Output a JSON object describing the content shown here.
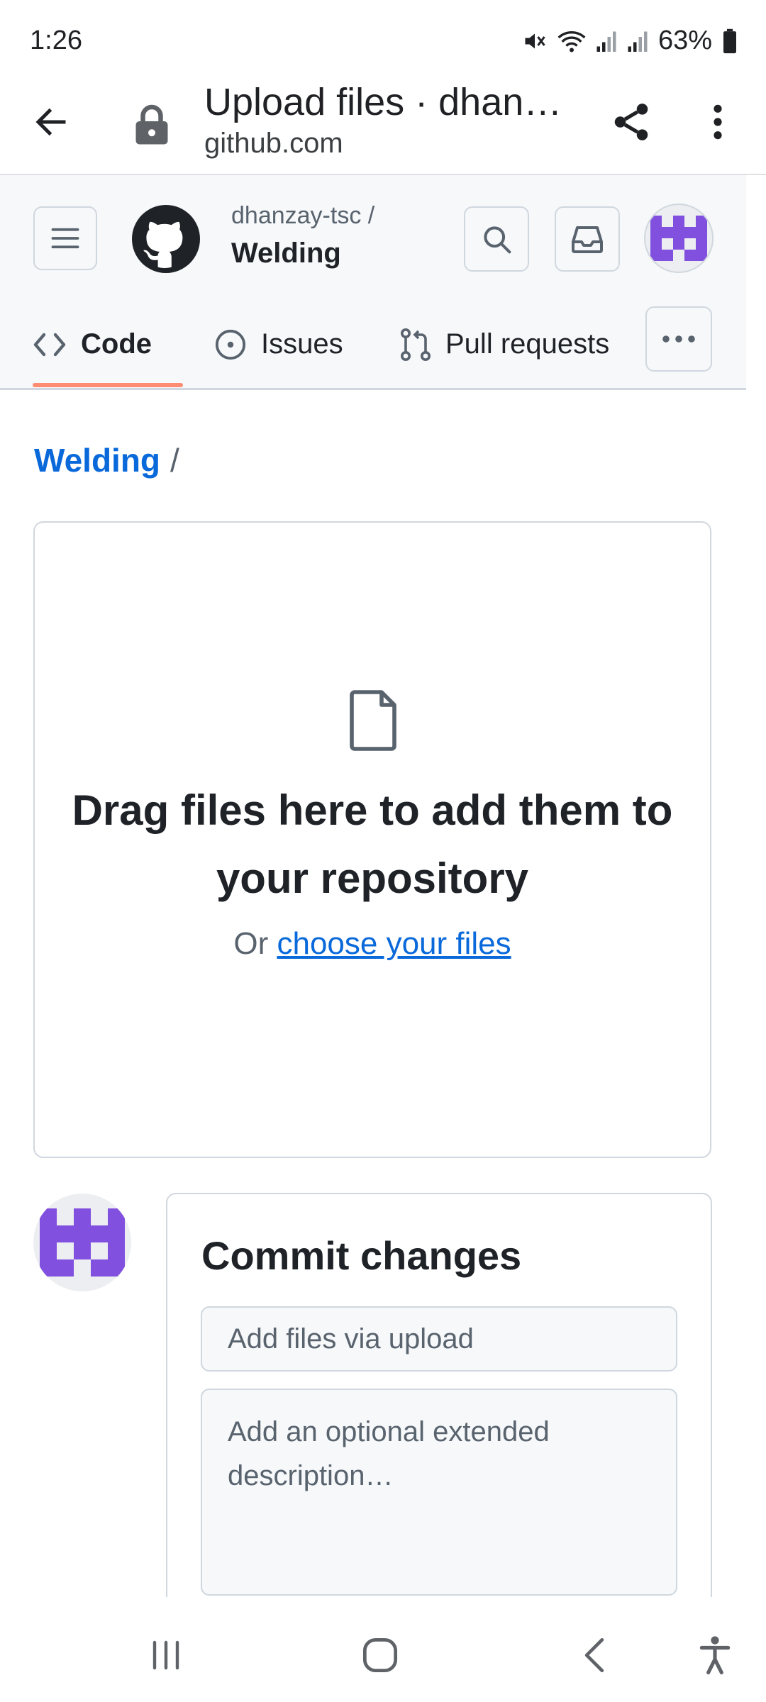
{
  "status_bar": {
    "time": "1:26",
    "battery": "63%"
  },
  "browser": {
    "title": "Upload files · dhanzay-tsc/Welding",
    "url": "github.com"
  },
  "repo": {
    "owner": "dhanzay-tsc /",
    "name": "Welding"
  },
  "tabs": [
    {
      "label": "Code",
      "icon": "code-icon",
      "selected": true
    },
    {
      "label": "Issues",
      "icon": "issue-circle-icon",
      "selected": false
    },
    {
      "label": "Pull requests",
      "icon": "pull-request-icon",
      "selected": false
    }
  ],
  "breadcrumb": {
    "repo_link": "Welding",
    "separator": "/"
  },
  "dropzone": {
    "title": "Drag files here to add them to your repository",
    "or_text": "Or",
    "choose_link": "choose your files"
  },
  "commit": {
    "heading": "Commit changes",
    "summary_placeholder": "Add files via upload",
    "description_placeholder": "Add an optional extended description…"
  },
  "colors": {
    "accent_link": "#0969da",
    "tab_underline": "#fd8c73",
    "avatar_purple": "#8250df"
  }
}
